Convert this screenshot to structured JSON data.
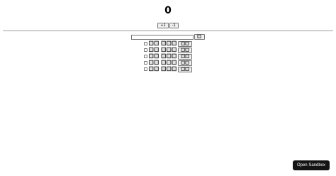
{
  "counter": {
    "value": "0",
    "increment_label": "+1",
    "decrement_label": "-1"
  },
  "todo": {
    "input_value": "",
    "add_label": "🔲",
    "items": [
      {
        "text": "🔲🔲 🔲🔲🔲",
        "delete_label": "🔲🔲",
        "checked": false
      },
      {
        "text": "🔲🔲 🔲🔲🔲",
        "delete_label": "🔲🔲",
        "checked": false
      },
      {
        "text": "🔲🔲 🔲🔲🔲",
        "delete_label": "🔲🔲",
        "checked": false
      },
      {
        "text": "🔲🔲 🔲🔲🔲",
        "delete_label": "🔲🔲",
        "checked": false
      },
      {
        "text": "🔲🔲 🔲🔲🔲",
        "delete_label": "🔲🔲",
        "checked": false
      }
    ]
  },
  "sandbox": {
    "label": "Open Sandbox"
  }
}
